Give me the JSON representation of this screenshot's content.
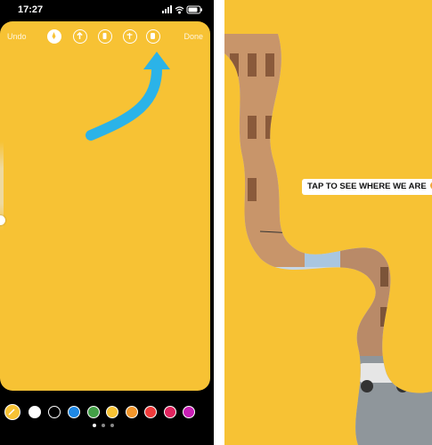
{
  "status_bar": {
    "time": "17:27"
  },
  "editor": {
    "undo_label": "Undo",
    "done_label": "Done",
    "tools": [
      "pen-tool-icon",
      "arrow-tool-icon",
      "marker-tool-icon",
      "neon-tool-icon",
      "eraser-tool-icon"
    ],
    "canvas_color": "#F7C234",
    "annotation_arrow_color": "#2BB3E8"
  },
  "palette": {
    "colors": [
      "#FFFFFF",
      "#000000",
      "#1E88E5",
      "#43A047",
      "#F7C234",
      "#F2962B",
      "#EF3B3B",
      "#E0245E",
      "#C81FB5"
    ]
  },
  "story": {
    "background_color": "#F7C234",
    "sticker_text": "TAP TO SEE WHERE WE ARE",
    "sticker_emoji": "smiling-emoji-icon"
  }
}
